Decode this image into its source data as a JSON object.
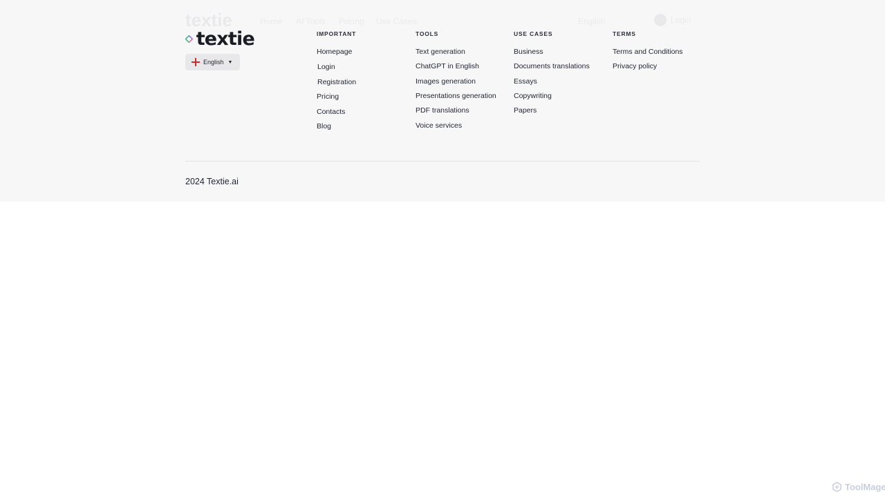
{
  "ghost_header": {
    "logo_text": "textie",
    "nav": [
      "Home",
      "AI Tools",
      "Pricing",
      "Use Cases"
    ],
    "language": "English",
    "login": "Login"
  },
  "brand": {
    "logo_text": "textie",
    "colors": {
      "green": "#3fb88a",
      "purple": "#7b6ee0",
      "pink": "#e86fa4"
    }
  },
  "language_selector": {
    "label": "English",
    "flag": "england-flag-icon",
    "chevron": "chevron-down-icon"
  },
  "columns": [
    {
      "heading": "IMPORTANT",
      "links": [
        "Homepage",
        "Login",
        "Registration",
        "Pricing",
        "Contacts",
        "Blog"
      ]
    },
    {
      "heading": "TOOLS",
      "links": [
        "Text generation",
        "ChatGPT in English",
        "Images generation",
        "Presentations generation",
        "PDF translations",
        "Voice services"
      ]
    },
    {
      "heading": "USE CASES",
      "links": [
        "Business",
        "Documents translations",
        "Essays",
        "Copywriting",
        "Papers"
      ]
    },
    {
      "heading": "TERMS",
      "links": [
        "Terms and Conditions",
        "Privacy policy"
      ]
    }
  ],
  "copyright": "2024 Textie.ai",
  "watermark": "ToolMage"
}
